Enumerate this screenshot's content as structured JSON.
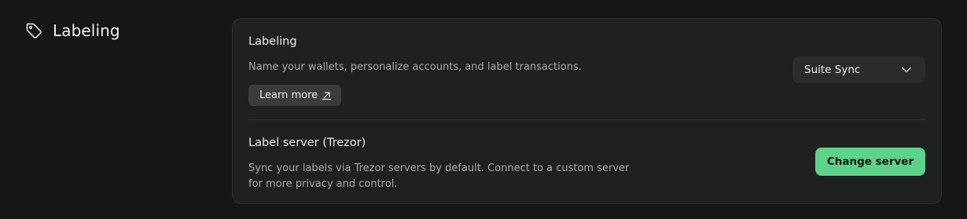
{
  "section": {
    "title": "Labeling",
    "icon": "tag-icon"
  },
  "labeling": {
    "title": "Labeling",
    "description": "Name your wallets, personalize accounts, and label transactions.",
    "learn_more_label": "Learn more",
    "learn_more_icon": "external-link-icon",
    "select_value": "Suite Sync",
    "select_icon": "chevron-down-icon"
  },
  "label_server": {
    "title": "Label server (Trezor)",
    "description": "Sync your labels via Trezor servers by default. Connect to a custom server for more privacy and control.",
    "button_label": "Change server"
  },
  "colors": {
    "background": "#161617",
    "card": "#1f2021",
    "accent_green": "#5dd38a",
    "secondary_button": "#3a3b3c"
  }
}
